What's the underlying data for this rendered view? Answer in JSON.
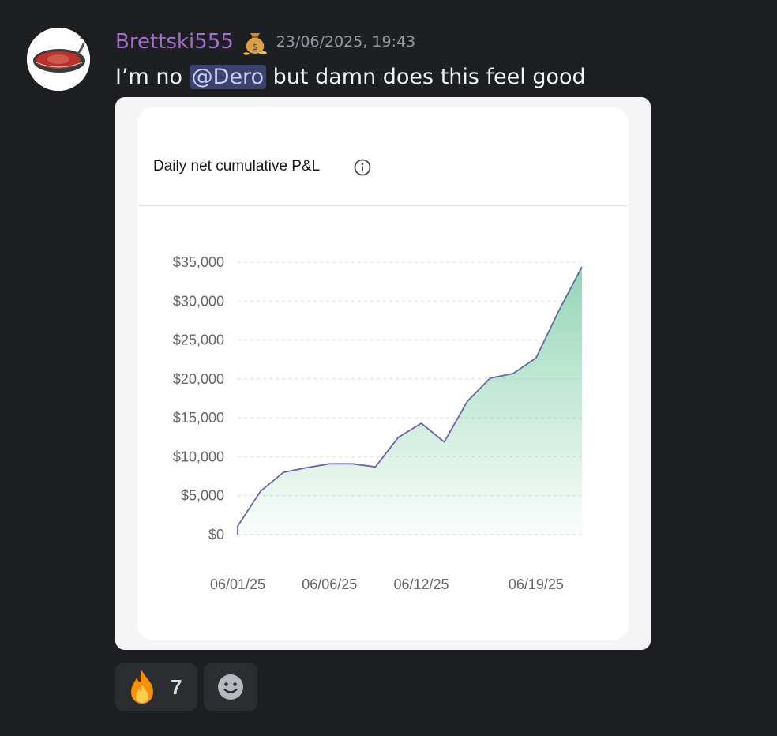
{
  "message": {
    "author": "Brettski555",
    "timestamp": "23/06/2025, 19:43",
    "author_badge_icon": "money-bag-icon",
    "author_color": "#a56ec9",
    "text_before": "I’m no ",
    "mention": "@Dero",
    "text_after": " but damn does this feel good"
  },
  "attachment": {
    "card_title": "Daily net cumulative P&L",
    "title_icon": "info-icon"
  },
  "chart_data": {
    "type": "area",
    "title": "Daily net cumulative P&L",
    "xlabel": "",
    "ylabel": "",
    "x_tick_labels": [
      "06/01/25",
      "06/06/25",
      "06/12/25",
      "06/19/25"
    ],
    "y_tick_labels": [
      "$0",
      "$5,000",
      "$10,000",
      "$15,000",
      "$20,000",
      "$25,000",
      "$30,000",
      "$35,000"
    ],
    "y_ticks": [
      0,
      5000,
      10000,
      15000,
      20000,
      25000,
      30000,
      35000
    ],
    "ylim": [
      0,
      35000
    ],
    "grid": true,
    "line_color": "#6e63a8",
    "fill_color": "#8fd3b3",
    "series": [
      {
        "x": [
          "06/01/25",
          "06/02/25",
          "06/03/25",
          "06/04/25",
          "06/05/25",
          "06/06/25",
          "06/09/25",
          "06/10/25",
          "06/11/25",
          "06/12/25",
          "06/13/25",
          "06/16/25",
          "06/17/25",
          "06/18/25",
          "06/19/25",
          "06/20/25",
          "06/23/25"
        ],
        "values": [
          0,
          1100,
          5600,
          8000,
          8600,
          9100,
          9100,
          8700,
          12500,
          14300,
          11900,
          17100,
          20100,
          20700,
          22700,
          28800,
          34400
        ]
      }
    ]
  },
  "reactions": [
    {
      "icon": "fire-emoji-icon",
      "count": "7"
    },
    {
      "icon": "add-reaction-icon"
    }
  ]
}
